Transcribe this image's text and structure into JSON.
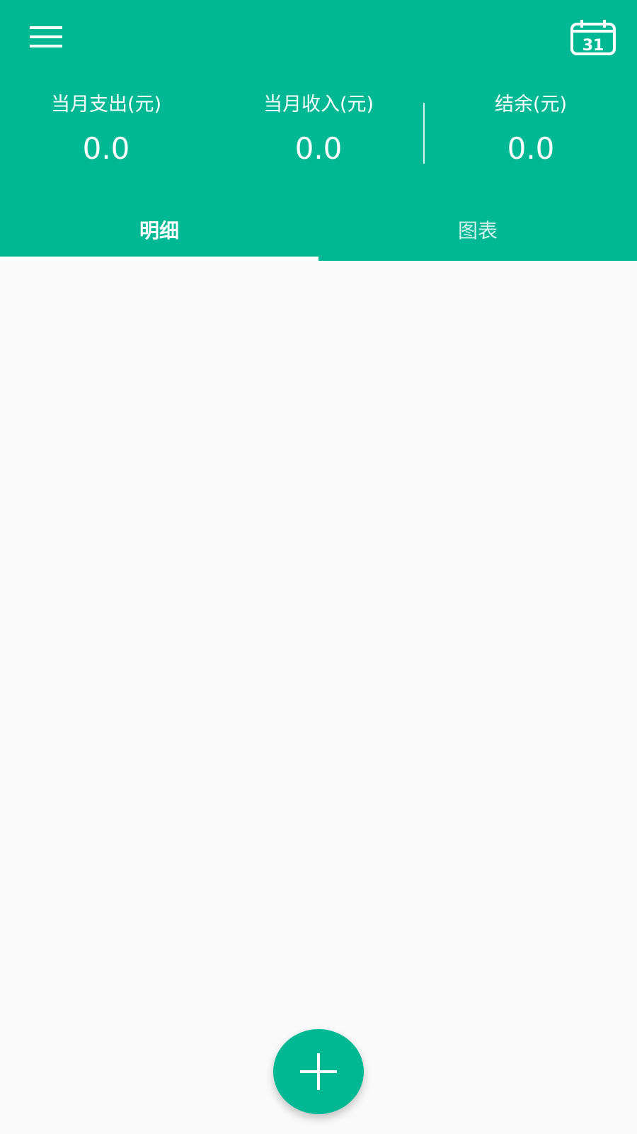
{
  "header": {
    "menu_icon": "menu-icon",
    "calendar_icon": "calendar-icon",
    "calendar_day": "31"
  },
  "summary": {
    "expense_label": "当月支出(元)",
    "expense_value": "0.0",
    "income_label": "当月收入(元)",
    "income_value": "0.0",
    "balance_label": "结余(元)",
    "balance_value": "0.0"
  },
  "tabs": [
    {
      "label": "明细",
      "selected": true
    },
    {
      "label": "图表",
      "selected": false
    }
  ],
  "fab": {
    "icon": "plus-icon"
  },
  "colors": {
    "primary": "#00b894",
    "background": "#fafafa",
    "on_primary": "#ffffff"
  }
}
